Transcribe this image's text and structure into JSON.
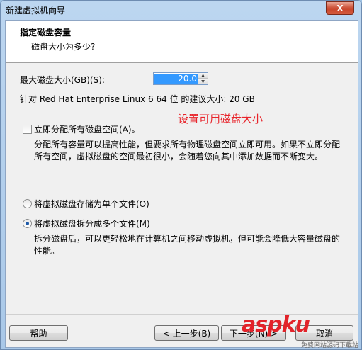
{
  "window": {
    "title": "新建虚拟机向导",
    "close_label": "X"
  },
  "header": {
    "title": "指定磁盘容量",
    "subtitle": "磁盘大小为多少?"
  },
  "disk": {
    "max_size_label": "最大磁盘大小(GB)(S):",
    "max_size_value": "20.0",
    "recommendation": "针对 Red Hat Enterprise Linux 6 64 位 的建议大小: 20 GB"
  },
  "annotation": {
    "text": "设置可用磁盘大小",
    "color": "#e8232a"
  },
  "allocate": {
    "label": "立即分配所有磁盘空间(A)。",
    "checked": false,
    "description": "分配所有容量可以提高性能，但要求所有物理磁盘空间立即可用。如果不立即分配所有空间，虚拟磁盘的空间最初很小，会随着您向其中添加数据而不断变大。"
  },
  "storage_options": [
    {
      "label": "将虚拟磁盘存储为单个文件(O)",
      "selected": false
    },
    {
      "label": "将虚拟磁盘拆分成多个文件(M)",
      "selected": true,
      "description": "拆分磁盘后，可以更轻松地在计算机之间移动虚拟机，但可能会降低大容量磁盘的性能。"
    }
  ],
  "buttons": {
    "help": "帮助",
    "back": "< 上一步(B)",
    "next": "下一步(N) >",
    "cancel": "取消"
  },
  "watermark": {
    "logo_text": "aspku",
    "sub_text": "免费网站源码下载站"
  }
}
